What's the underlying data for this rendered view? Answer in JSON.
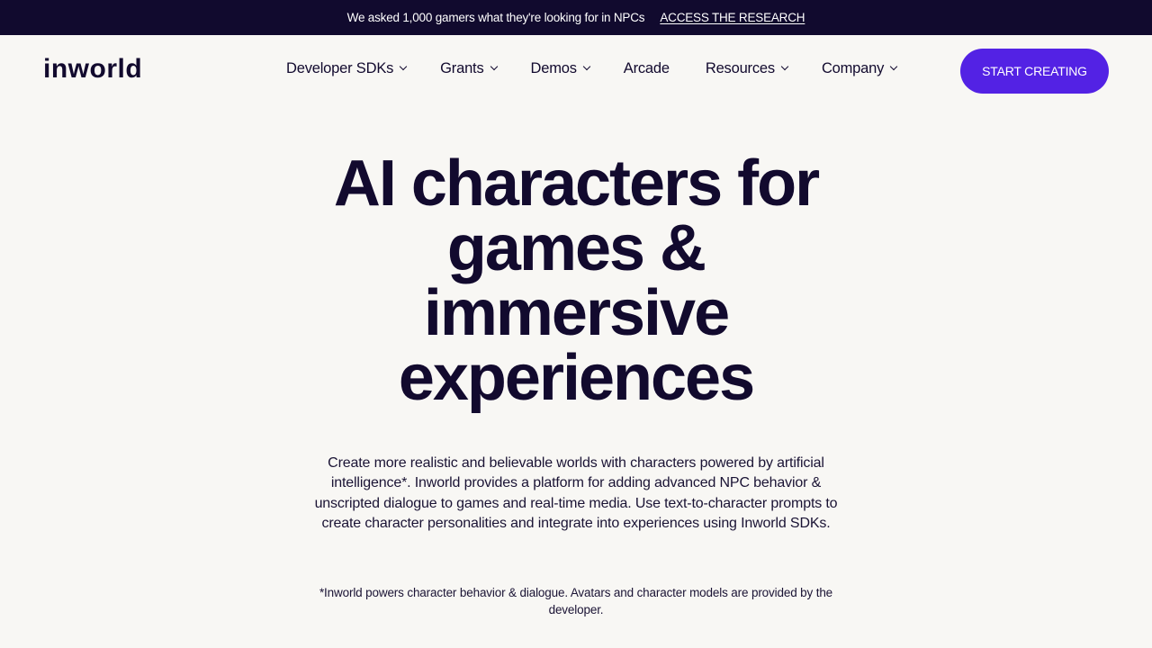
{
  "announcement": {
    "message": "We asked 1,000 gamers what they're looking for in NPCs",
    "link_label": "ACCESS THE RESEARCH"
  },
  "header": {
    "logo": "inworld",
    "nav": [
      {
        "label": "Developer SDKs",
        "dropdown": true
      },
      {
        "label": "Grants",
        "dropdown": true
      },
      {
        "label": "Demos",
        "dropdown": true
      },
      {
        "label": "Arcade",
        "dropdown": false
      },
      {
        "label": "Resources",
        "dropdown": true
      },
      {
        "label": "Company",
        "dropdown": true
      }
    ],
    "cta_label": "START CREATING"
  },
  "hero": {
    "title_lines": [
      "AI characters for",
      "games &",
      "immersive",
      "experiences"
    ],
    "description": "Create more realistic and believable worlds with characters powered by artificial intelligence*. Inworld provides a platform for adding advanced NPC behavior & unscripted dialogue to games and real-time media. Use text-to-character prompts to create character personalities and integrate into experiences using Inworld SDKs.",
    "footnote": "*Inworld powers character behavior & dialogue. Avatars and character models are provided by the developer."
  },
  "colors": {
    "announcement_bg": "#110a2e",
    "page_bg": "#f8f7f4",
    "text_dark": "#120a2e",
    "cta_bg": "#5322e4"
  }
}
